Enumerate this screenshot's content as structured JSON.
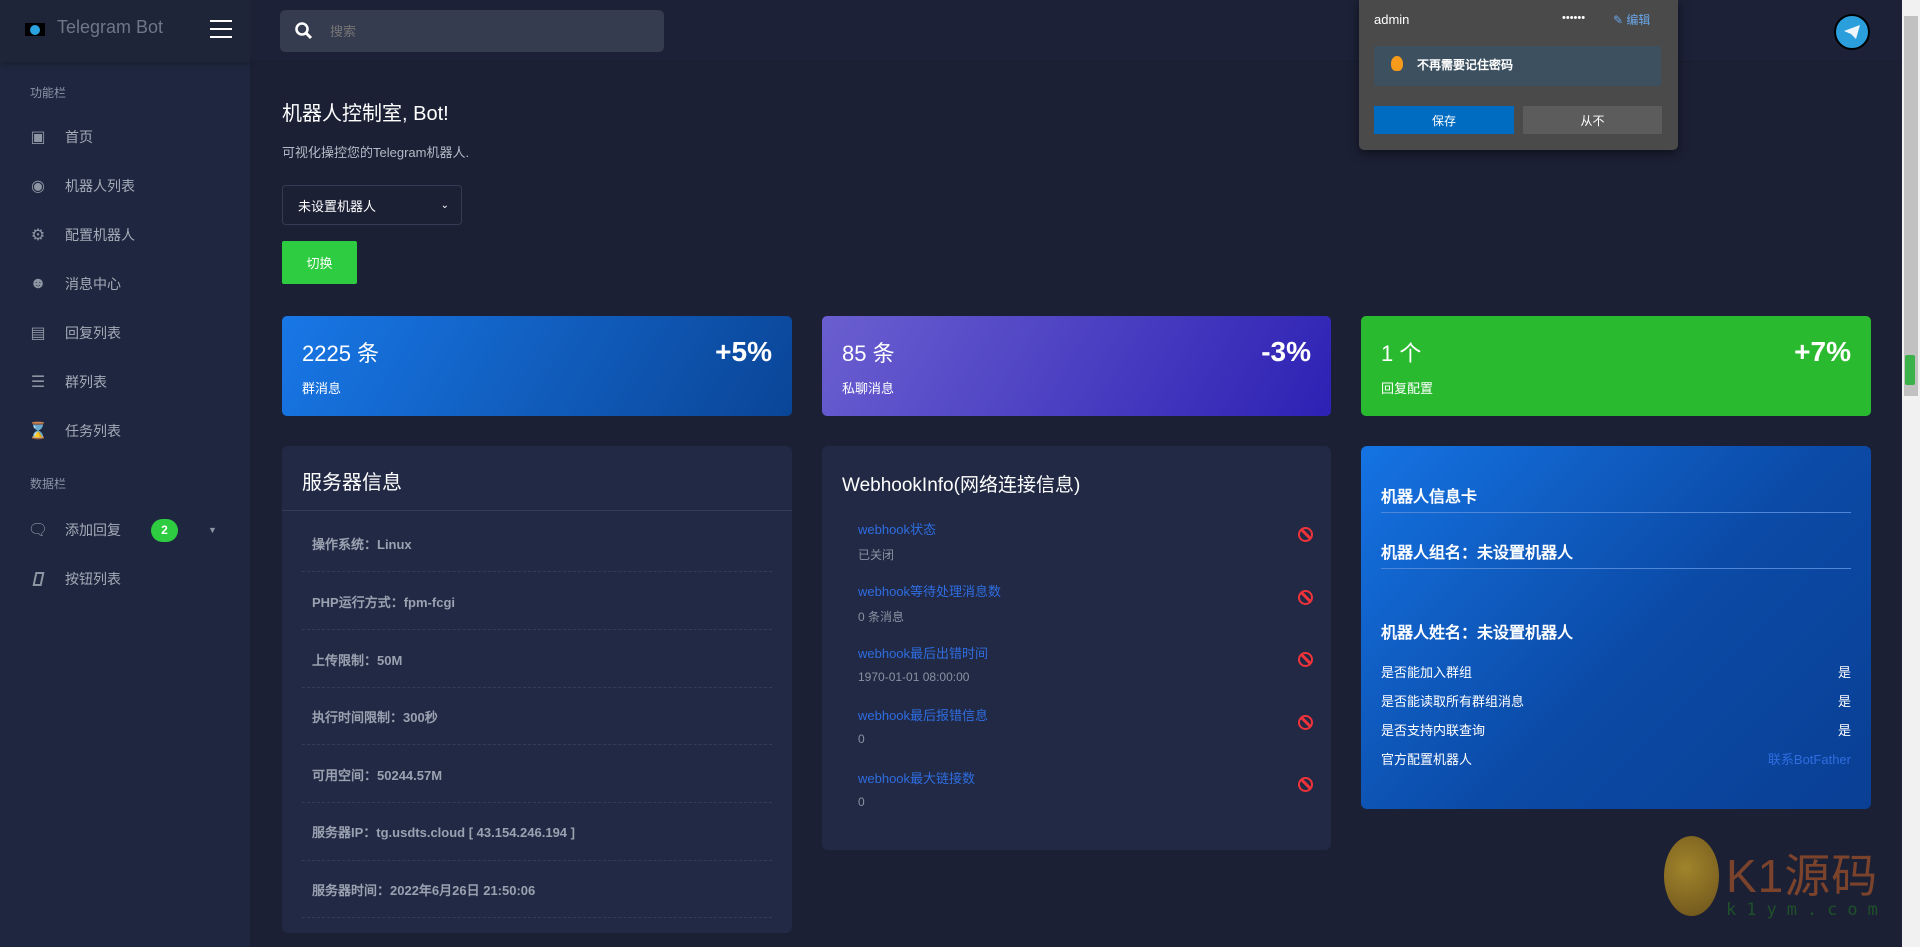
{
  "brand": {
    "name": "Telegram Bot"
  },
  "search": {
    "placeholder": "搜索"
  },
  "password_popup": {
    "username": "admin",
    "password_mask": "••••••",
    "edit_label": "编辑",
    "notice": "不再需要记住密码",
    "save_label": "保存",
    "never_label": "从不"
  },
  "sidebar": {
    "section1": "功能栏",
    "items": [
      {
        "label": "首页",
        "icon": "robot-icon"
      },
      {
        "label": "机器人列表",
        "icon": "user-circle-icon"
      },
      {
        "label": "配置机器人",
        "icon": "cogs-icon"
      },
      {
        "label": "消息中心",
        "icon": "smile-icon"
      },
      {
        "label": "回复列表",
        "icon": "newspaper-icon"
      },
      {
        "label": "群列表",
        "icon": "layers-icon"
      },
      {
        "label": "任务列表",
        "icon": "hourglass-icon"
      }
    ],
    "section2": "数据栏",
    "items2": [
      {
        "label": "添加回复",
        "icon": "comments-icon",
        "badge": "2"
      },
      {
        "label": "按钮列表",
        "icon": "square-icon"
      }
    ]
  },
  "main": {
    "title": "机器人控制室, Bot!",
    "subtitle": "可视化操控您的Telegram机器人.",
    "select_value": "未设置机器人",
    "switch_label": "切换"
  },
  "stats": [
    {
      "value": "2225 条",
      "change": "+5%",
      "label": "群消息"
    },
    {
      "value": "85 条",
      "change": "-3%",
      "label": "私聊消息"
    },
    {
      "value": "1 个",
      "change": "+7%",
      "label": "回复配置"
    }
  ],
  "server": {
    "title": "服务器信息",
    "rows": [
      "操作系统：Linux",
      "PHP运行方式：fpm-fcgi",
      "上传限制：50M",
      "执行时间限制：300秒",
      "可用空间：50244.57M",
      "服务器IP：tg.usdts.cloud [ 43.154.246.194 ]",
      "服务器时间：2022年6月26日 21:50:06"
    ]
  },
  "webhook": {
    "title": "WebhookInfo(网络连接信息)",
    "items": [
      {
        "key": "webhook状态",
        "value": "已关闭"
      },
      {
        "key": "webhook等待处理消息数",
        "value": "0 条消息"
      },
      {
        "key": "webhook最后出错时间",
        "value": "1970-01-01 08:00:00"
      },
      {
        "key": "webhook最后报错信息",
        "value": "0"
      },
      {
        "key": "webhook最大链接数",
        "value": "0"
      }
    ]
  },
  "botcard": {
    "title": "机器人信息卡",
    "group_name": "机器人组名：未设置机器人",
    "bot_name": "机器人姓名：未设置机器人",
    "rows": [
      {
        "label": "是否能加入群组",
        "value": "是"
      },
      {
        "label": "是否能读取所有群组消息",
        "value": "是"
      },
      {
        "label": "是否支持内联查询",
        "value": "是"
      },
      {
        "label": "官方配置机器人",
        "value": "联系BotFather"
      }
    ]
  },
  "watermark": {
    "text": "K1源码",
    "domain": "k1ym.com"
  },
  "colors": {
    "green": "#2ecc40",
    "blue_grad": "#1877e6",
    "purple_grad": "#6a5fd0",
    "link": "#2f6de1"
  }
}
